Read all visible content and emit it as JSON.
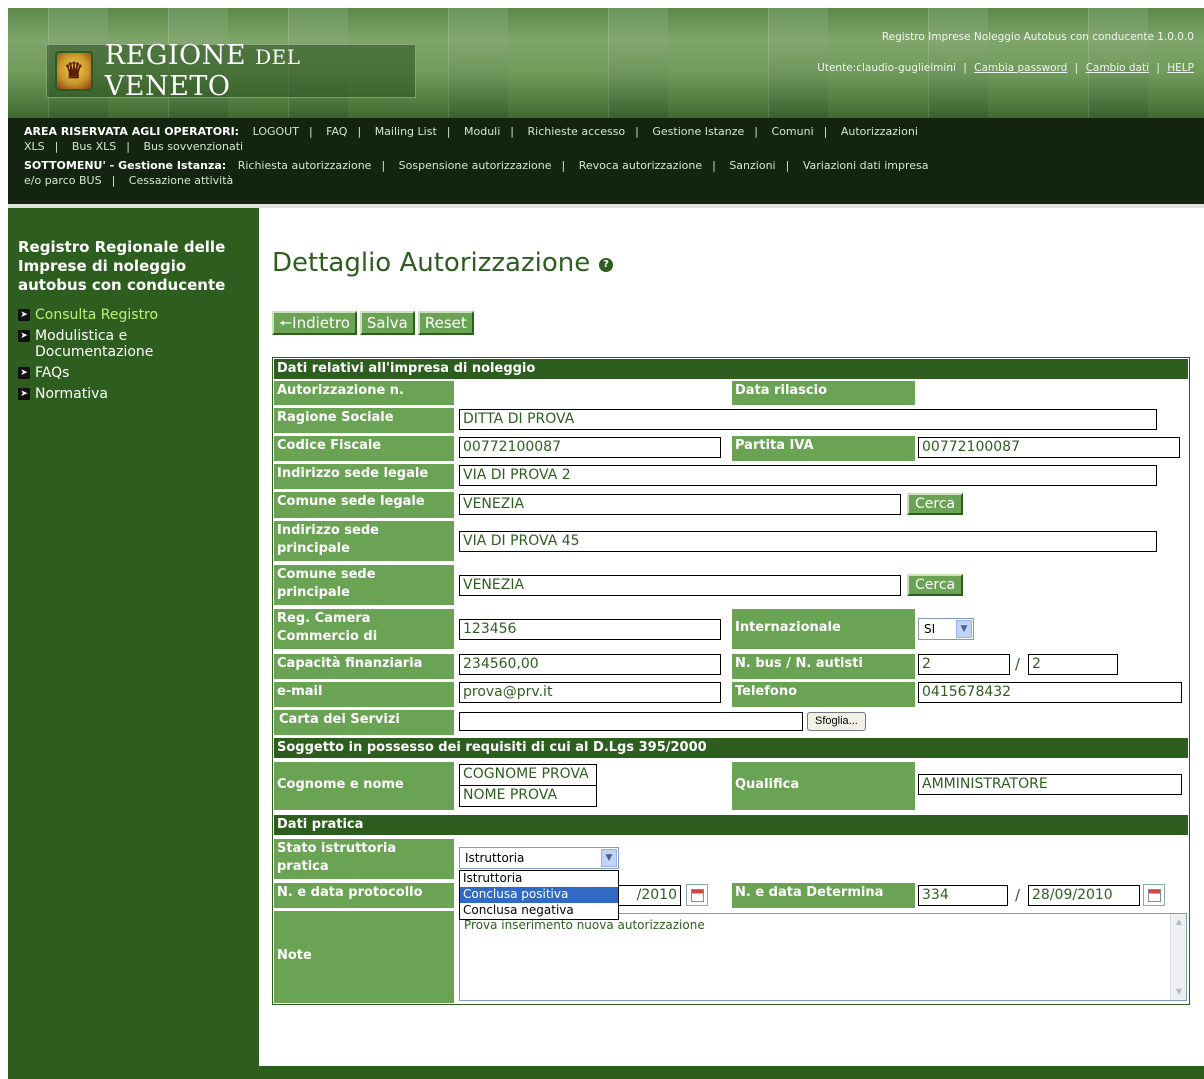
{
  "header": {
    "logo_emblem": "lion-emblem",
    "logo_word1": "REGIONE",
    "logo_word2": "DEL",
    "logo_word3": "VENETO",
    "app_title": "Registro Imprese Noleggio Autobus con conducente 1.0.0.0",
    "user_label": "Utente:claudio-guglielmini",
    "links": [
      "Cambia password",
      "Cambio dati",
      "HELP"
    ]
  },
  "menubar": {
    "area_label": "AREA RISERVATA AGLI OPERATORI:",
    "area_items": [
      "LOGOUT",
      "FAQ",
      "Mailing List",
      "Moduli",
      "Richieste accesso",
      "Gestione Istanze",
      "Comuni",
      "Autorizzazioni"
    ],
    "area_items_2": [
      "XLS",
      "Bus XLS",
      "Bus sovvenzionati"
    ],
    "sub_label": "SOTTOMENU' - Gestione Istanza:",
    "sub_items": [
      "Richiesta autorizzazione",
      "Sospensione autorizzazione",
      "Revoca autorizzazione",
      "Sanzioni",
      "Variazioni dati impresa"
    ],
    "sub_items_2": [
      "e/o parco BUS",
      "Cessazione attività"
    ]
  },
  "sidebar": {
    "title": "Registro Regionale delle Imprese di noleggio autobus con conducente",
    "items": [
      {
        "label": "Consulta Registro",
        "active": true
      },
      {
        "label": "Modulistica e Documentazione",
        "active": false
      },
      {
        "label": "FAQs",
        "active": false
      },
      {
        "label": "Normativa",
        "active": false
      }
    ]
  },
  "main": {
    "title": "Dettaglio Autorizzazione",
    "help_icon": "?",
    "toolbar": {
      "back": "Indietro",
      "save": "Salva",
      "reset": "Reset"
    }
  },
  "form": {
    "section1": "Dati relativi all'impresa di noleggio",
    "labels": {
      "autorizzazione": "Autorizzazione n.",
      "data_rilascio": "Data rilascio",
      "ragione_sociale": "Ragione Sociale",
      "codice_fiscale": "Codice Fiscale",
      "partita_iva": "Partita IVA",
      "indirizzo_legale": "Indirizzo sede legale",
      "comune_legale": "Comune sede legale",
      "indirizzo_principale_1": "Indirizzo sede",
      "indirizzo_principale_2": "principale",
      "comune_principale_1": "Comune sede",
      "comune_principale_2": "principale",
      "reg_camera_1": "Reg. Camera",
      "reg_camera_2": "Commercio di",
      "internazionale": "Internazionale",
      "capacita": "Capacità finanziaria",
      "nbus": "N. bus / N. autisti",
      "email": "e-mail",
      "telefono": "Telefono",
      "carta": "Carta dei Servizi",
      "cognome": "Cognome e nome",
      "qualifica": "Qualifica",
      "stato_1": "Stato istruttoria",
      "stato_2": "pratica",
      "protocollo": "N. e data protocollo",
      "determina": "N. e data Determina",
      "note": "Note"
    },
    "values": {
      "ragione_sociale": "DITTA DI PROVA",
      "codice_fiscale": "00772100087",
      "partita_iva": "00772100087",
      "indirizzo_legale": "VIA DI PROVA 2",
      "comune_legale": "VENEZIA",
      "indirizzo_principale": "VIA DI PROVA 45",
      "comune_principale": "VENEZIA",
      "reg_camera": "123456",
      "internazionale": "SI",
      "capacita": "234560,00",
      "nbus": "2",
      "nautisti": "2",
      "email": "prova@prv.it",
      "telefono": "0415678432",
      "cognome": "COGNOME PROVA",
      "nome": "NOME PROVA",
      "qualifica": "AMMINISTRATORE",
      "stato": "Istruttoria",
      "protocollo_data_tail": "/2010",
      "determina_n": "334",
      "determina_data": "28/09/2010",
      "note": "Prova inserimento nuova autorizzazione"
    },
    "cerca_label": "Cerca",
    "sfoglia_label": "Sfoglia...",
    "section2": "Soggetto in possesso dei requisiti di cui al D.Lgs 395/2000",
    "section3": "Dati pratica",
    "stato_options": [
      "Istruttoria",
      "Conclusa positiva",
      "Conclusa negativa"
    ],
    "slash": "/"
  }
}
